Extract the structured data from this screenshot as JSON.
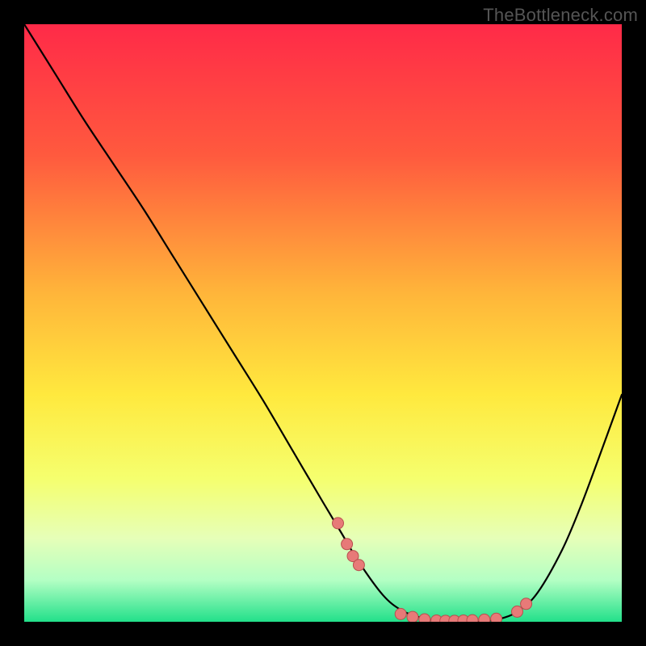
{
  "watermark": "TheBottleneck.com",
  "chart_data": {
    "type": "line",
    "title": "",
    "xlabel": "",
    "ylabel": "",
    "xlim": [
      0,
      100
    ],
    "ylim": [
      0,
      100
    ],
    "background_gradient": {
      "stops": [
        {
          "offset": 0,
          "color": "#ff2a48"
        },
        {
          "offset": 22,
          "color": "#ff5a3e"
        },
        {
          "offset": 45,
          "color": "#ffb53a"
        },
        {
          "offset": 62,
          "color": "#ffe93e"
        },
        {
          "offset": 76,
          "color": "#f5ff6e"
        },
        {
          "offset": 86,
          "color": "#e6ffb8"
        },
        {
          "offset": 93,
          "color": "#b4ffc4"
        },
        {
          "offset": 100,
          "color": "#22e08a"
        }
      ]
    },
    "grid": false,
    "series": [
      {
        "name": "bottleneck-curve",
        "color": "#000000",
        "stroke_width": 2.2,
        "x": [
          0,
          5,
          10,
          15,
          20,
          25,
          30,
          35,
          40,
          45,
          50,
          53,
          56,
          60,
          63,
          66,
          70,
          73,
          76,
          80,
          83,
          86,
          90,
          93,
          96,
          100
        ],
        "y": [
          100,
          92,
          84,
          76.5,
          69,
          61,
          53,
          45,
          37,
          28.5,
          20,
          15,
          10,
          4.5,
          2,
          0.8,
          0,
          0,
          0,
          0.6,
          2,
          5,
          12,
          19,
          27,
          38
        ]
      }
    ],
    "markers": {
      "name": "highlight-points",
      "color": "#e77a78",
      "stroke": "#b84f4e",
      "radius": 7,
      "points": [
        {
          "x": 52.5,
          "y": 16.5
        },
        {
          "x": 54.0,
          "y": 13.0
        },
        {
          "x": 55.0,
          "y": 11.0
        },
        {
          "x": 56.0,
          "y": 9.5
        },
        {
          "x": 63.0,
          "y": 1.3
        },
        {
          "x": 65.0,
          "y": 0.8
        },
        {
          "x": 67.0,
          "y": 0.4
        },
        {
          "x": 69.0,
          "y": 0.2
        },
        {
          "x": 70.5,
          "y": 0.15
        },
        {
          "x": 72.0,
          "y": 0.15
        },
        {
          "x": 73.5,
          "y": 0.2
        },
        {
          "x": 75.0,
          "y": 0.25
        },
        {
          "x": 77.0,
          "y": 0.35
        },
        {
          "x": 79.0,
          "y": 0.5
        },
        {
          "x": 82.5,
          "y": 1.7
        },
        {
          "x": 84.0,
          "y": 3.0
        }
      ]
    }
  }
}
